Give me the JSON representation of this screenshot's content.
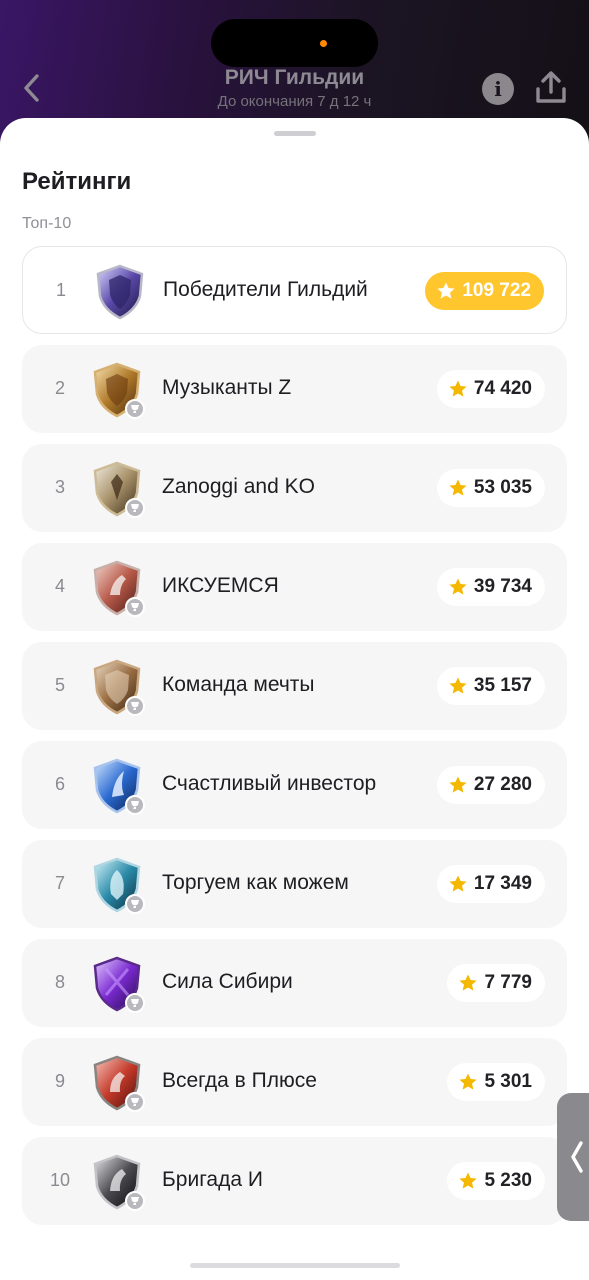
{
  "header": {
    "title": "РИЧ Гильдии",
    "subtitle": "До окончания 7 д 12 ч",
    "back_icon": "chevron-left-icon",
    "info_icon": "info-icon",
    "share_icon": "share-icon"
  },
  "sheet": {
    "title": "Рейтинги",
    "subtitle": "Топ-10"
  },
  "colors": {
    "accent_gold": "#ffc62e",
    "star": "#f5b800",
    "header_purple": "#3a1666"
  },
  "leaderboard": [
    {
      "rank": "1",
      "name": "Победители Гильдий",
      "score": "109 722",
      "emblem": "violet-silver-shield"
    },
    {
      "rank": "2",
      "name": "Музыканты Z",
      "score": "74 420",
      "emblem": "gold-lion-shield"
    },
    {
      "rank": "3",
      "name": "Zanoggi and KO",
      "score": "53 035",
      "emblem": "eagle-shield"
    },
    {
      "rank": "4",
      "name": "ИКСУЕМСЯ",
      "score": "39 734",
      "emblem": "red-horse-shield"
    },
    {
      "rank": "5",
      "name": "Команда мечты",
      "score": "35 157",
      "emblem": "bronze-shield"
    },
    {
      "rank": "6",
      "name": "Счастливый инвестор",
      "score": "27 280",
      "emblem": "blue-dolphin-shield"
    },
    {
      "rank": "7",
      "name": "Торгуем как можем",
      "score": "17 349",
      "emblem": "teal-phoenix-shield"
    },
    {
      "rank": "8",
      "name": "Сила Сибири",
      "score": "7 779",
      "emblem": "purple-crystal-shield"
    },
    {
      "rank": "9",
      "name": "Всегда в Плюсе",
      "score": "5 301",
      "emblem": "red-lion-shield"
    },
    {
      "rank": "10",
      "name": "Бригада И",
      "score": "5 230",
      "emblem": "black-horse-shield"
    }
  ],
  "side_handle_icon": "chevron-left-icon"
}
